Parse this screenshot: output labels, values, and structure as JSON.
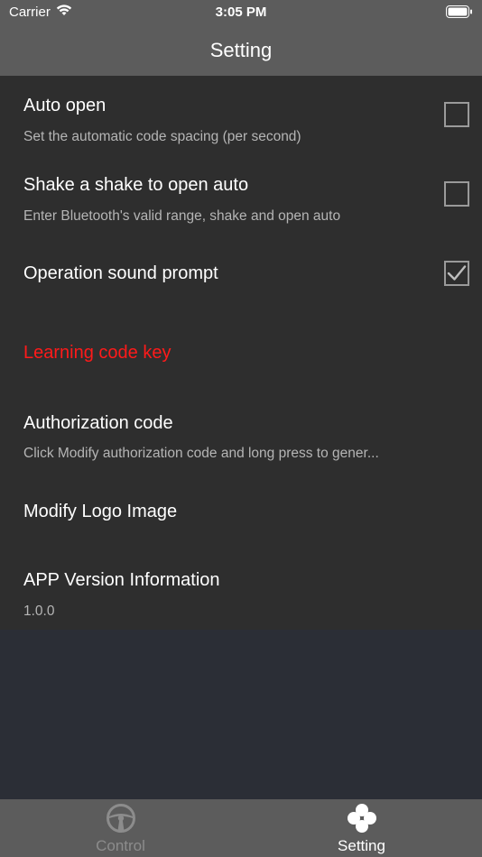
{
  "status_bar": {
    "carrier": "Carrier",
    "time": "3:05 PM",
    "icons": [
      "wifi-icon",
      "battery-icon"
    ]
  },
  "nav": {
    "title": "Setting"
  },
  "settings": {
    "auto_open": {
      "title": "Auto open",
      "subtitle": "Set the automatic code spacing (per second)",
      "checked": false
    },
    "shake_open": {
      "title": "Shake a shake to open auto",
      "subtitle": "Enter Bluetooth's valid range, shake and open auto",
      "checked": false
    },
    "sound_prompt": {
      "title": "Operation sound prompt",
      "checked": true
    },
    "learning_code": {
      "title": "Learning code key",
      "color": "#ff1a1a"
    },
    "authorization": {
      "title": "Authorization code",
      "subtitle": "Click Modify authorization code and long press to gener..."
    },
    "modify_logo": {
      "title": "Modify Logo Image"
    },
    "app_version": {
      "title": "APP Version Information",
      "subtitle": "1.0.0"
    }
  },
  "tabs": [
    {
      "label": "Control",
      "icon": "steering-wheel-icon",
      "active": false
    },
    {
      "label": "Setting",
      "icon": "four-circles-icon",
      "active": true
    }
  ],
  "colors": {
    "bar_background": "#5c5c5c",
    "list_background": "#2e2e2e",
    "page_background": "#2b2e36",
    "accent_red": "#ff1a1a"
  }
}
